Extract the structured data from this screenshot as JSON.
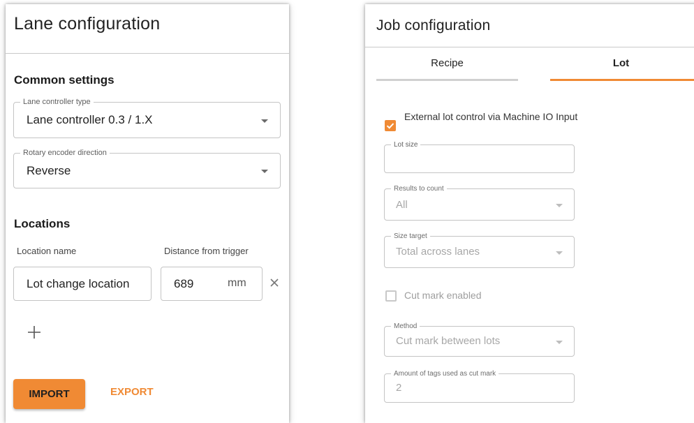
{
  "lane_config": {
    "title": "Lane configuration",
    "common_settings_title": "Common settings",
    "controller_type": {
      "label": "Lane controller type",
      "value": "Lane controller 0.3 / 1.X"
    },
    "encoder_direction": {
      "label": "Rotary encoder direction",
      "value": "Reverse"
    },
    "locations_title": "Locations",
    "location_name_header": "Location name",
    "distance_header": "Distance from trigger",
    "location_row": {
      "name": "Lot change location",
      "distance": "689",
      "unit": "mm"
    },
    "import_label": "IMPORT",
    "export_label": "EXPORT"
  },
  "job_config": {
    "title": "Job configuration",
    "tabs": [
      {
        "label": "Recipe",
        "active": false
      },
      {
        "label": "Lot",
        "active": true
      }
    ],
    "external_lot": {
      "label": "External lot control via Machine IO Input",
      "checked": true
    },
    "lot_size": {
      "label": "Lot size",
      "value": ""
    },
    "results_to_count": {
      "label": "Results to count",
      "value": "All"
    },
    "size_target": {
      "label": "Size target",
      "value": "Total across lanes"
    },
    "cut_mark": {
      "label": "Cut mark enabled",
      "checked": false
    },
    "method": {
      "label": "Method",
      "value": "Cut mark between lots"
    },
    "tags_amount": {
      "label": "Amount of tags used as cut mark",
      "value": "2"
    }
  },
  "colors": {
    "accent": "#f08a34",
    "tab_inactive_underline": "#d0d0d0",
    "border": "#c4c4c4",
    "disabled_text": "#a7a7a7"
  },
  "icons": [
    "dropdown-caret-icon",
    "remove-x-icon",
    "add-plus-icon",
    "checkmark-icon"
  ]
}
